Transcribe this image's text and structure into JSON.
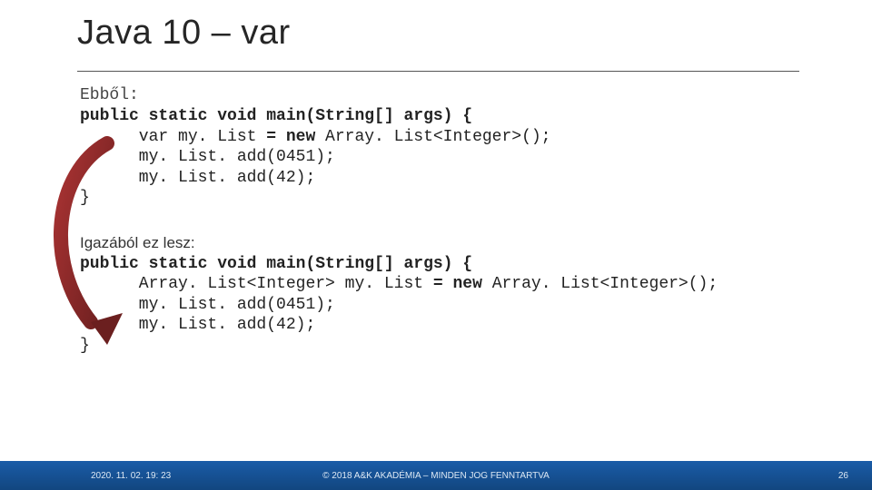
{
  "title": "Java 10 – var",
  "block1": {
    "label": "Ebből:",
    "line1_kw": "public static void ",
    "line1_b": "main(String[] args) {",
    "line2_a": "      var my. List ",
    "line2_kw": "= new ",
    "line2_b": "Array. List<Integer>();",
    "line3": "      my. List. add(0451);",
    "line4": "      my. List. add(42);",
    "line5": "}"
  },
  "block2": {
    "label": "Igazából ez lesz:",
    "line1_kw": "public static void ",
    "line1_b": "main(String[] args) {",
    "line2_a": "      Array. List<Integer> my. List ",
    "line2_kw": "= new ",
    "line2_b": "Array. List<Integer>();",
    "line3": "      my. List. add(0451);",
    "line4": "      my. List. add(42);",
    "line5": "}"
  },
  "footer": {
    "timestamp": "2020. 11. 02. 19: 23",
    "copyright": "© 2018 A&K AKADÉMIA – MINDEN JOG FENNTARTVA",
    "page": "26"
  }
}
